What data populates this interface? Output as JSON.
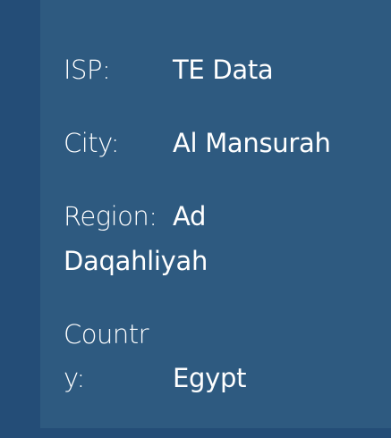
{
  "info": {
    "isp": {
      "label": "ISP:",
      "value": "TE Data"
    },
    "city": {
      "label": "City:",
      "value": "Al Mansurah"
    },
    "region": {
      "label": "Region:",
      "value_line1": "Ad",
      "value_line2": "Daqahliyah"
    },
    "country": {
      "label_line1": "Countr",
      "label_line2": "y:",
      "value": "Egypt"
    }
  },
  "colors": {
    "background": "#244d77",
    "panel": "#2e5a80",
    "text": "#ffffff"
  }
}
